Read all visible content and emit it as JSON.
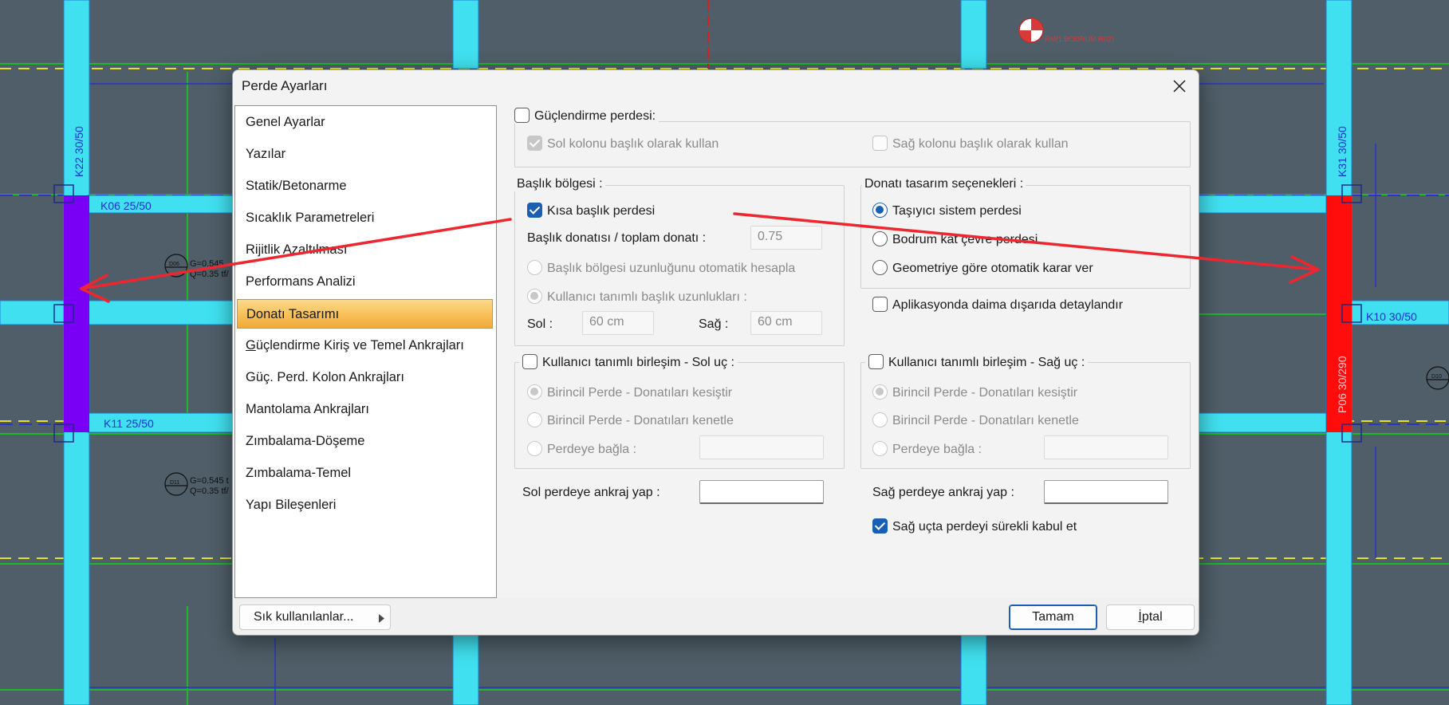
{
  "background": {
    "beam_labels": [
      "K06 25/50",
      "K11 25/50",
      "K10 30/50"
    ],
    "column_labels": [
      "K22 30/50",
      "K31 30/50",
      "P06 30/290"
    ],
    "load_labels": [
      "G=0.545",
      "Q=0.35 tf/",
      "G=0.545 t",
      "Q=0.35 tf/"
    ],
    "slab_labels": [
      "D06",
      "D11",
      "D10"
    ],
    "marker_label": "RM(1.BODRUM-R02)",
    "colors": {
      "beam": "#40e0f0",
      "wall_left": "#7a00f5",
      "wall_right": "#ff0d0d",
      "annotation": "#ee2630"
    }
  },
  "dialog": {
    "title": "Perde Ayarları",
    "close_icon": "close-icon",
    "nav": {
      "items": [
        {
          "label": "Genel Ayarlar"
        },
        {
          "label": "Yazılar"
        },
        {
          "label": "Statik/Betonarme"
        },
        {
          "label": "Sıcaklık Parametreleri"
        },
        {
          "label": "Rijitlik Azaltılması"
        },
        {
          "label": "Performans Analizi"
        },
        {
          "label": "Donatı Tasarımı",
          "selected": true
        },
        {
          "label_first": "G",
          "label_rest": "üçlendirme Kiriş ve Temel Ankrajları"
        },
        {
          "label": "Güç. Perd. Kolon Ankrajları"
        },
        {
          "label": "Mantolama Ankrajları"
        },
        {
          "label": "Zımbalama-Döşeme"
        },
        {
          "label": "Zımbalama-Temel"
        },
        {
          "label": "Yapı Bileşenleri"
        }
      ]
    },
    "strengthening": {
      "label": "Güçlendirme perdesi:",
      "checked": false,
      "left_column": "Sol kolonu başlık olarak kullan",
      "right_column": "Sağ kolonu başlık olarak kullan"
    },
    "header_region": {
      "title": "Başlık bölgesi :",
      "short_header": "Kısa başlık perdesi",
      "ratio_label": "Başlık donatısı / toplam donatı :",
      "ratio_value": "0.75",
      "auto_length": "Başlık bölgesi uzunluğunu otomatik hesapla",
      "user_lengths": "Kullanıcı tanımlı başlık uzunlukları :",
      "left_label": "Sol :",
      "left_value": "60 cm",
      "right_label": "Sağ :",
      "right_value": "60 cm"
    },
    "design_options": {
      "title": "Donatı tasarım seçenekleri :",
      "options": [
        "Taşıyıcı sistem perdesi",
        "Bodrum kat çevre perdesi",
        "Geometriye göre otomatik karar ver"
      ],
      "selected_index": 0,
      "detail_outside": "Aplikasyonda daima dışarıda detaylandır"
    },
    "left_join": {
      "title": "Kullanıcı tanımlı birleşim - Sol uç :",
      "options": [
        "Birincil Perde - Donatıları kesiştir",
        "Birincil Perde - Donatıları kenetle",
        "Perdeye bağla :"
      ]
    },
    "right_join": {
      "title": "Kullanıcı tanımlı birleşim - Sağ uç :",
      "options": [
        "Birincil Perde - Donatıları kesiştir",
        "Birincil Perde - Donatıları kenetle",
        "Perdeye bağla :"
      ]
    },
    "anchors": {
      "left_label": "Sol perdeye ankraj yap :",
      "left_value": "",
      "right_label": "Sağ perdeye ankraj yap :",
      "right_value": ""
    },
    "continuous_right": "Sağ uçta perdeyi sürekli kabul et",
    "footer": {
      "favorites": "Sık kullanılanlar...",
      "ok": "Tamam",
      "cancel_first": "İ",
      "cancel_rest": "ptal"
    }
  }
}
